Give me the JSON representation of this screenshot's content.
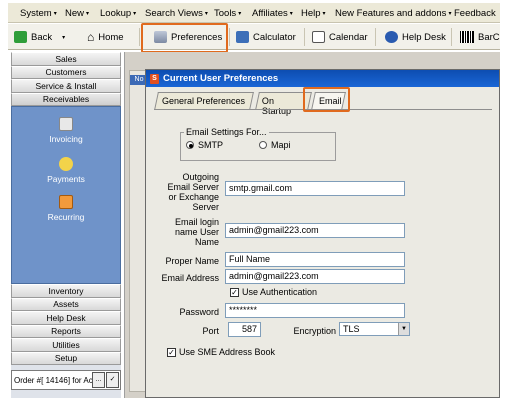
{
  "menu": [
    {
      "label": "System",
      "arrow": "▾"
    },
    {
      "label": "New",
      "arrow": "▾"
    },
    {
      "label": "Lookup",
      "arrow": "▾"
    },
    {
      "label": "Search Views",
      "arrow": "▾"
    },
    {
      "label": "Tools",
      "arrow": "▾"
    },
    {
      "label": "Affiliates",
      "arrow": "▾"
    },
    {
      "label": "Help",
      "arrow": "▾"
    },
    {
      "label": "New Features and addons",
      "arrow": "▾"
    },
    {
      "label": "Feedback",
      "arrow": ""
    }
  ],
  "toolbar": {
    "back": "Back",
    "home": "Home",
    "preferences": "Preferences",
    "calculator": "Calculator",
    "calendar": "Calendar",
    "help_desk": "Help Desk",
    "barcode": "BarC"
  },
  "sidebar": {
    "top_items": [
      "Sales",
      "Customers",
      "Service & Install",
      "Receivables"
    ],
    "sub_items": [
      "Invoicing",
      "Payments",
      "Recurring"
    ],
    "bottom_items": [
      "Inventory",
      "Assets",
      "Help Desk",
      "Reports",
      "Utilities",
      "Setup"
    ],
    "order_text": "Order #[ 14146] for Ac",
    "order_button": "..."
  },
  "bg_window": {
    "tab_label": "No"
  },
  "dialog": {
    "title": "Current User Preferences",
    "tabs": [
      "General Preferences",
      "On Startup",
      "Email"
    ],
    "group_label": "Email Settings For...",
    "radio_smtp": "SMTP",
    "radio_mapi": "Mapi",
    "outgoing_label": "Outgoing Email Server or Exchange Server",
    "outgoing_value": "smtp.gmail.com",
    "login_label": "Email login name User Name",
    "login_value": "admin@gmail223.com",
    "proper_name_label": "Proper Name",
    "proper_name_value": "Full Name",
    "email_address_label": "Email Address",
    "email_address_value": "admin@gmail223.com",
    "use_auth_label": "Use Authentication",
    "password_label": "Password",
    "password_value": "********",
    "port_label": "Port",
    "port_value": "587",
    "encryption_label": "Encryption",
    "encryption_value": "TLS",
    "sme_label": "Use SME Address Book"
  },
  "colors": {
    "highlight": "#e06a1e",
    "title_bar": "#1a66d6",
    "sidebar_panel": "#6f93c9"
  }
}
